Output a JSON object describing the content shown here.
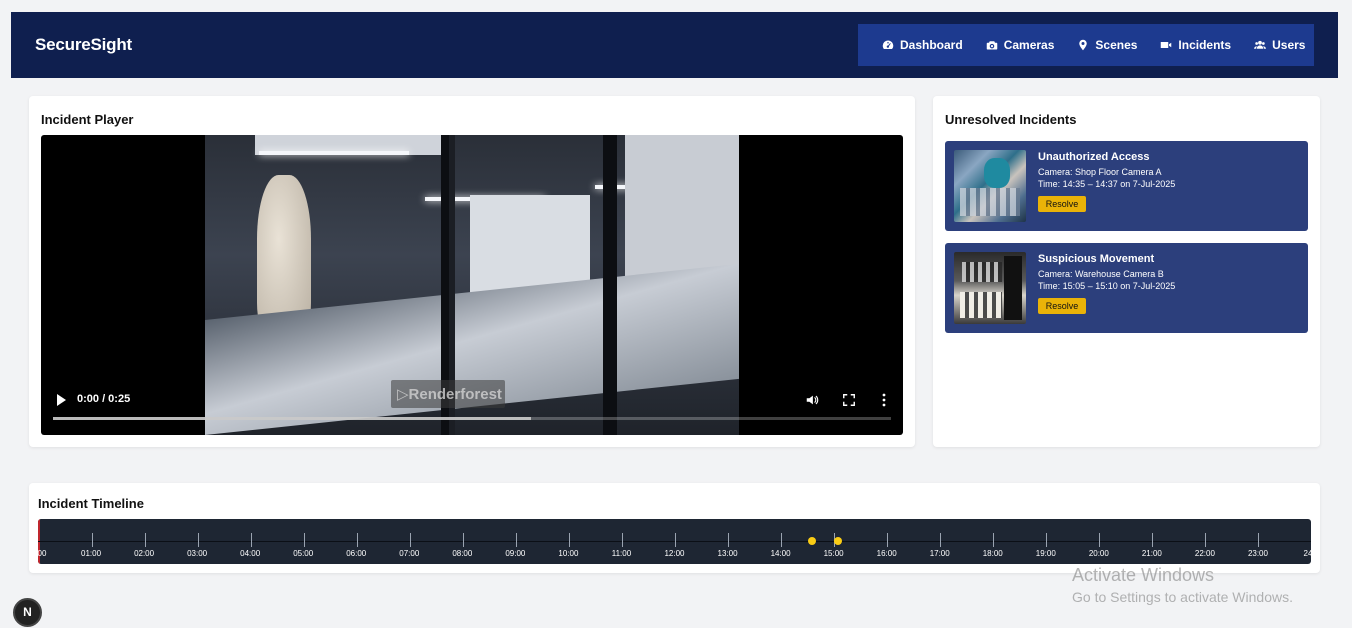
{
  "header": {
    "brand": "SecureSight",
    "nav": [
      {
        "label": "Dashboard",
        "icon": "gauge-icon"
      },
      {
        "label": "Cameras",
        "icon": "camera-icon"
      },
      {
        "label": "Scenes",
        "icon": "map-pin-icon"
      },
      {
        "label": "Incidents",
        "icon": "video-icon"
      },
      {
        "label": "Users",
        "icon": "users-icon"
      }
    ]
  },
  "player": {
    "title": "Incident Player",
    "watermark": "Renderforest",
    "time": "0:00 / 0:25",
    "buffered_fraction": 0.57
  },
  "unresolved": {
    "title": "Unresolved Incidents",
    "items": [
      {
        "title": "Unauthorized Access",
        "camera": "Camera: Shop Floor Camera A",
        "time": "Time: 14:35 – 14:37 on 7-Jul-2025",
        "action": "Resolve"
      },
      {
        "title": "Suspicious Movement",
        "camera": "Camera: Warehouse Camera B",
        "time": "Time: 15:05 – 15:10 on 7-Jul-2025",
        "action": "Resolve"
      }
    ]
  },
  "timeline": {
    "title": "Incident Timeline",
    "labels": [
      "00",
      "01:00",
      "02:00",
      "03:00",
      "04:00",
      "05:00",
      "06:00",
      "07:00",
      "08:00",
      "09:00",
      "10:00",
      "11:00",
      "12:00",
      "13:00",
      "14:00",
      "15:00",
      "16:00",
      "17:00",
      "18:00",
      "19:00",
      "20:00",
      "21:00",
      "22:00",
      "23:00",
      "24"
    ],
    "markers_hours": [
      14.583,
      15.083
    ],
    "colors": {
      "marker": "#facc15",
      "bar": "#1e2633",
      "start_line": "#c0262d"
    }
  },
  "os_overlay": {
    "line1": "Activate Windows",
    "line2": "Go to Settings to activate Windows."
  },
  "badge": "N"
}
